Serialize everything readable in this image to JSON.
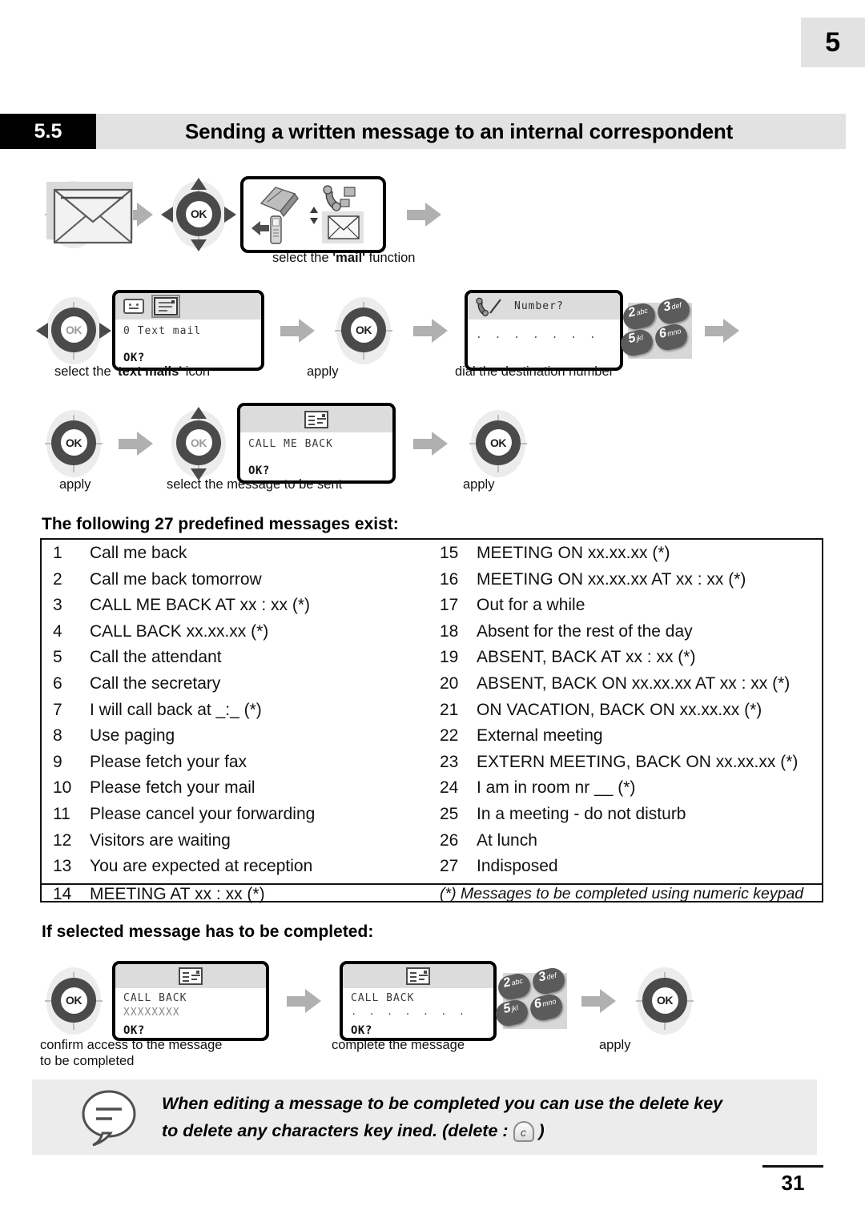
{
  "page": {
    "chapter_tab": "5",
    "page_number": "31"
  },
  "section": {
    "number": "5.5",
    "title": "Sending a written message to an internal correspondent"
  },
  "flow1": {
    "captions": {
      "mail_function_prefix": "select the ",
      "mail_function_bold": "'mail'",
      "mail_function_suffix": " function"
    }
  },
  "flow2": {
    "screen_textmail": {
      "line": "0 Text mail",
      "ok": "OK?"
    },
    "screen_number": {
      "header": "Number?",
      "dots": ". . . . . . .",
      "ok": ""
    },
    "captions": {
      "text_mails_prefix": "select the ",
      "text_mails_bold": "'text mails'",
      "text_mails_suffix": " icon",
      "apply": "apply",
      "dial": "dial the destination number"
    },
    "keypad": {
      "k2_num": "2",
      "k2_sub": "abc",
      "k3_num": "3",
      "k3_sub": "def",
      "k5_num": "5",
      "k5_sub": "jkl",
      "k6_num": "6",
      "k6_sub": "mno"
    }
  },
  "flow3": {
    "screen_callmeback": {
      "line": "CALL ME BACK",
      "ok": "OK?"
    },
    "captions": {
      "apply_left": "apply",
      "select_message": "select the message to be sent",
      "apply_right": "apply"
    }
  },
  "messages": {
    "heading": "The following 27 predefined messages exist:",
    "left": [
      {
        "num": "1",
        "text": "Call me back"
      },
      {
        "num": "2",
        "text": "Call me back tomorrow"
      },
      {
        "num": "3",
        "text": "CALL ME BACK AT xx : xx (*)"
      },
      {
        "num": "4",
        "text": "CALL BACK xx.xx.xx (*)"
      },
      {
        "num": "5",
        "text": "Call the attendant"
      },
      {
        "num": "6",
        "text": "Call the secretary"
      },
      {
        "num": "7",
        "text": "I will call back at _:_ (*)"
      },
      {
        "num": "8",
        "text": "Use paging"
      },
      {
        "num": "9",
        "text": "Please fetch your fax"
      },
      {
        "num": "10",
        "text": "Please fetch your mail"
      },
      {
        "num": "11",
        "text": "Please cancel your forwarding"
      },
      {
        "num": "12",
        "text": "Visitors are waiting"
      },
      {
        "num": "13",
        "text": "You are expected at reception"
      },
      {
        "num": "14",
        "text": "MEETING AT xx : xx (*)"
      }
    ],
    "right": [
      {
        "num": "15",
        "text": "MEETING ON xx.xx.xx (*)"
      },
      {
        "num": "16",
        "text": "MEETING ON xx.xx.xx AT xx : xx (*)"
      },
      {
        "num": "17",
        "text": "Out for a while"
      },
      {
        "num": "18",
        "text": "Absent for the rest of the day"
      },
      {
        "num": "19",
        "text": "ABSENT, BACK AT xx : xx (*)"
      },
      {
        "num": "20",
        "text": "ABSENT, BACK ON xx.xx.xx AT xx : xx (*)"
      },
      {
        "num": "21",
        "text": "ON VACATION, BACK ON xx.xx.xx (*)"
      },
      {
        "num": "22",
        "text": "External meeting"
      },
      {
        "num": "23",
        "text": "EXTERN MEETING, BACK ON xx.xx.xx (*)"
      },
      {
        "num": "24",
        "text": "I am in room nr __ (*)"
      },
      {
        "num": "25",
        "text": "In a meeting - do not disturb"
      },
      {
        "num": "26",
        "text": "At lunch"
      },
      {
        "num": "27",
        "text": "Indisposed"
      }
    ],
    "footnote": "(*) Messages to be completed using numeric keypad"
  },
  "completion": {
    "heading": "If selected message has to be completed:",
    "screen_a": {
      "line1": "CALL BACK",
      "line2": "XXXXXXXX",
      "ok": "OK?"
    },
    "screen_b": {
      "line1": "CALL BACK",
      "line2": ". . . . . . .",
      "ok": "OK?"
    },
    "keypad": {
      "k2_num": "2",
      "k2_sub": "abc",
      "k3_num": "3",
      "k3_sub": "def",
      "k5_num": "5",
      "k5_sub": "jkl",
      "k6_num": "6",
      "k6_sub": "mno"
    },
    "captions": {
      "confirm_line1": "confirm access to the message",
      "confirm_line2": "to be completed",
      "complete": "complete the message",
      "apply": "apply"
    }
  },
  "note": {
    "line1": "When editing a message to be completed you can use the delete key",
    "line2_a": "to delete any characters key ined. (delete : ",
    "key_label": "c",
    "line2_b": " )"
  },
  "labels": {
    "ok": "OK"
  },
  "colors": {
    "band_grey": "#e2e2e2",
    "tab_black": "#000000",
    "arrow_grey": "#b0b0b0",
    "note_grey": "#ececec",
    "lcd_header_grey": "#dcdcdc",
    "pad_dark": "#4a4a4a"
  }
}
